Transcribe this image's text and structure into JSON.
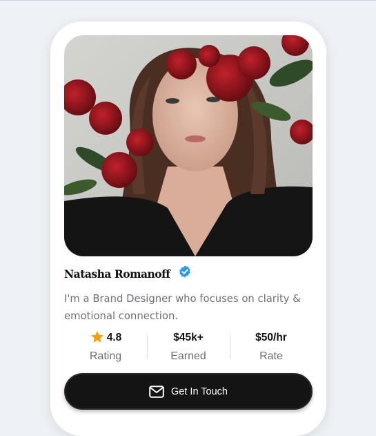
{
  "profile": {
    "name": "Natasha Romanoff",
    "verified": true,
    "photo_description_icon": "portrait-photo",
    "bio": "I'm a Brand Designer who focuses on clarity & emotional connection."
  },
  "stats": [
    {
      "value": "4.8",
      "label": "Rating",
      "icon": "star-icon"
    },
    {
      "value": "$45k+",
      "label": "Earned"
    },
    {
      "value": "$50/hr",
      "label": "Rate"
    }
  ],
  "cta": {
    "label": "Get In Touch",
    "icon": "mail-icon"
  },
  "colors": {
    "page_bg": "#eef1f5",
    "card_bg": "#ffffff",
    "verified_blue": "#2f9be8",
    "star_orange": "#f5a00f",
    "button_bg": "#141414",
    "muted_text": "#6b6f76"
  }
}
